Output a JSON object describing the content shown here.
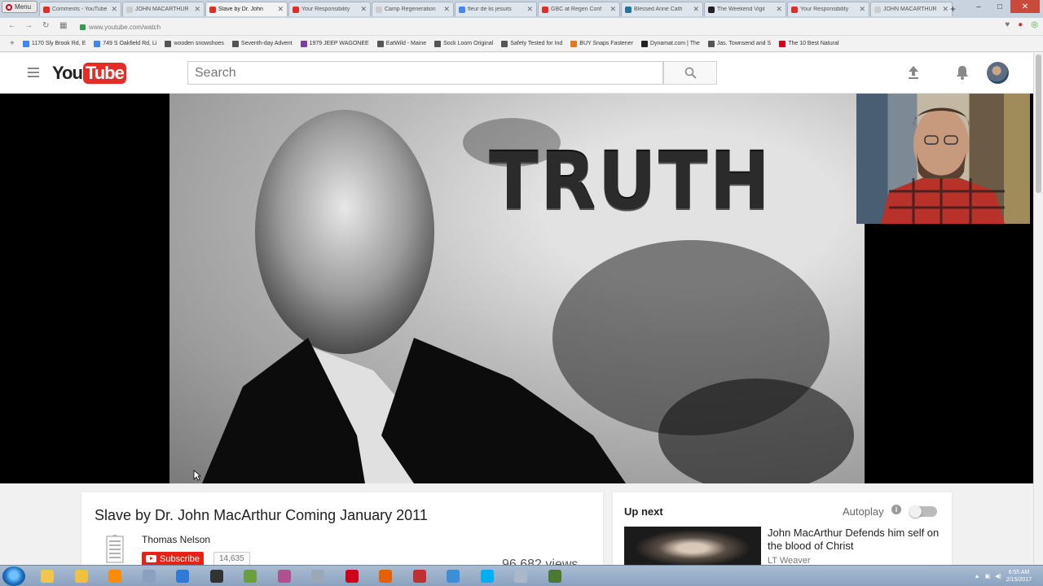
{
  "browser": {
    "menu_label": "Menu",
    "tabs": [
      {
        "label": "Comments - YouTube",
        "color": "#e52d27",
        "active": false
      },
      {
        "label": "JOHN MACARTHUR",
        "color": "#cccccc",
        "active": false
      },
      {
        "label": "Slave by Dr. John",
        "color": "#e52d27",
        "active": true
      },
      {
        "label": "Your Responsibility",
        "color": "#e52d27",
        "active": false
      },
      {
        "label": "Camp Regeneration",
        "color": "#cccccc",
        "active": false
      },
      {
        "label": "fleur de lis jesuits",
        "color": "#4285f4",
        "active": false
      },
      {
        "label": "GBC at Regen Conf",
        "color": "#e52d27",
        "active": false
      },
      {
        "label": "Blessed Anne Cath",
        "color": "#21759b",
        "active": false
      },
      {
        "label": "The Weekend Vigil",
        "color": "#222222",
        "active": false
      },
      {
        "label": "Your Responsibility",
        "color": "#e52d27",
        "active": false
      },
      {
        "label": "JOHN MACARTHUR",
        "color": "#cccccc",
        "active": false
      }
    ],
    "tab_close": "✕",
    "new_tab": "+",
    "url": "www.youtube.com/watch",
    "bookmarks": [
      {
        "label": "1170 Sly Brook Rd, E",
        "color": "#4285f4"
      },
      {
        "label": "749 S Oakfield Rd, Li",
        "color": "#4285f4"
      },
      {
        "label": "wooden snowshoes",
        "color": "#555555"
      },
      {
        "label": "Seventh-day Advent",
        "color": "#555555"
      },
      {
        "label": "1979 JEEP WAGONEE",
        "color": "#7b3fa0"
      },
      {
        "label": "EatWild - Maine",
        "color": "#555555"
      },
      {
        "label": "Sock Loom Original",
        "color": "#555555"
      },
      {
        "label": "Safety Tested for Ind",
        "color": "#555555"
      },
      {
        "label": "BUY Snaps Fastener",
        "color": "#e07a20"
      },
      {
        "label": "Dynamat.com | The",
        "color": "#222222"
      },
      {
        "label": "Jas. Townsend and S",
        "color": "#555555"
      },
      {
        "label": "The 10 Best Natural",
        "color": "#d0021b"
      }
    ]
  },
  "header": {
    "logo_you": "You",
    "logo_tube": "Tube",
    "search_placeholder": "Search"
  },
  "video": {
    "overlay_text": "TRUTH",
    "title": "Slave by Dr. John MacArthur Coming January 2011",
    "channel": "Thomas Nelson",
    "subscribe_label": "Subscribe",
    "subscriber_count": "14,635",
    "views": "96,682 views"
  },
  "upnext": {
    "label": "Up next",
    "autoplay_label": "Autoplay",
    "info": "i",
    "next_title": "John MacArthur Defends him self on the blood of Christ",
    "next_channel": "LT Weaver"
  },
  "taskbar": {
    "time": "6:55 AM",
    "date": "2/15/2017",
    "apps": [
      {
        "name": "explorer",
        "color": "#f3c54c"
      },
      {
        "name": "folder",
        "color": "#f0c040"
      },
      {
        "name": "media",
        "color": "#ff8c00"
      },
      {
        "name": "tool",
        "color": "#8aa0c0"
      },
      {
        "name": "app-blue",
        "color": "#2f7bd6"
      },
      {
        "name": "camera",
        "color": "#333333"
      },
      {
        "name": "calendar",
        "color": "#6b9e3f"
      },
      {
        "name": "people",
        "color": "#b05090"
      },
      {
        "name": "settings",
        "color": "#9aa8b8"
      },
      {
        "name": "opera",
        "color": "#d0021b"
      },
      {
        "name": "firefox",
        "color": "#e66000"
      },
      {
        "name": "bug",
        "color": "#c03030"
      },
      {
        "name": "network",
        "color": "#3a8fd8"
      },
      {
        "name": "skype",
        "color": "#00aff0"
      },
      {
        "name": "display",
        "color": "#aab8c8"
      },
      {
        "name": "paint",
        "color": "#4a7a30"
      }
    ]
  }
}
